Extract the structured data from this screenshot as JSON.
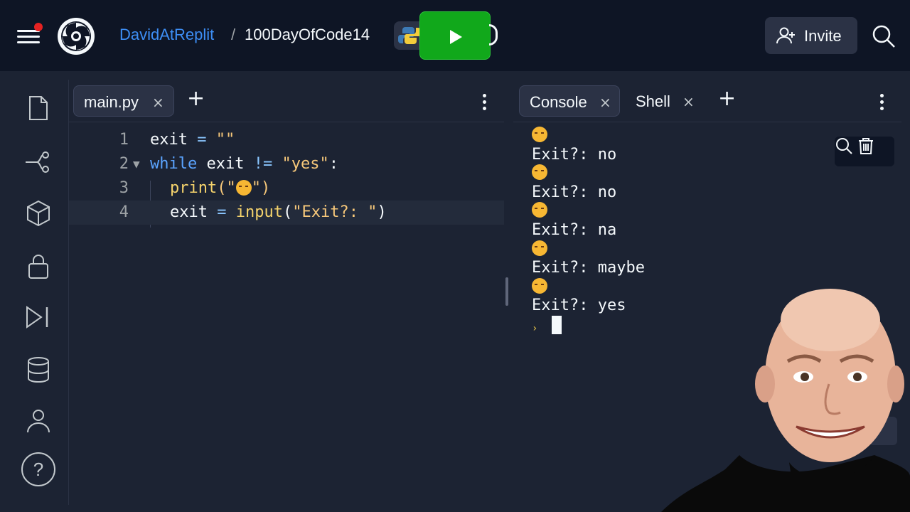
{
  "header": {
    "user": "DavidAtReplit",
    "separator": "/",
    "repl_name": "100DayOfCode14",
    "invite_label": "Invite"
  },
  "sidebar": {
    "items": [
      "files-icon",
      "git-icon",
      "packages-icon",
      "secrets-icon",
      "debugger-icon",
      "database-icon",
      "user-icon"
    ],
    "help_label": "?"
  },
  "editor": {
    "tab_label": "main.py",
    "close_glyph": "×",
    "add_glyph": "+",
    "lines": [
      {
        "num": "1"
      },
      {
        "num": "2"
      },
      {
        "num": "3"
      },
      {
        "num": "4"
      }
    ],
    "code": {
      "l1_var": "exit",
      "l1_eq": " = ",
      "l1_str": "\"\"",
      "l2_kw": "while",
      "l2_var": " exit ",
      "l2_op": "!=",
      "l2_str": " \"yes\"",
      "l2_colon": ":",
      "l3_fn": "print",
      "l3_open": "(\"",
      "l3_close": "\")",
      "l4_var": "exit",
      "l4_eq": " = ",
      "l4_fn": "input",
      "l4_open": "(",
      "l4_str": "\"Exit?: \"",
      "l4_close": ")"
    }
  },
  "console": {
    "tab_console": "Console",
    "tab_shell": "Shell",
    "close_glyph": "×",
    "add_glyph": "+",
    "output": [
      {
        "prompt": "Exit?: ",
        "answer": "no"
      },
      {
        "prompt": "Exit?: ",
        "answer": "no"
      },
      {
        "prompt": "Exit?: ",
        "answer": "na"
      },
      {
        "prompt": "Exit?: ",
        "answer": "maybe"
      },
      {
        "prompt": "Exit?: ",
        "answer": "yes"
      }
    ],
    "prompt_glyph": "›"
  },
  "colors": {
    "accent": "#3d8ef5",
    "run_green": "#11a81b",
    "background": "#1c2333",
    "topbar": "#0e1525"
  }
}
